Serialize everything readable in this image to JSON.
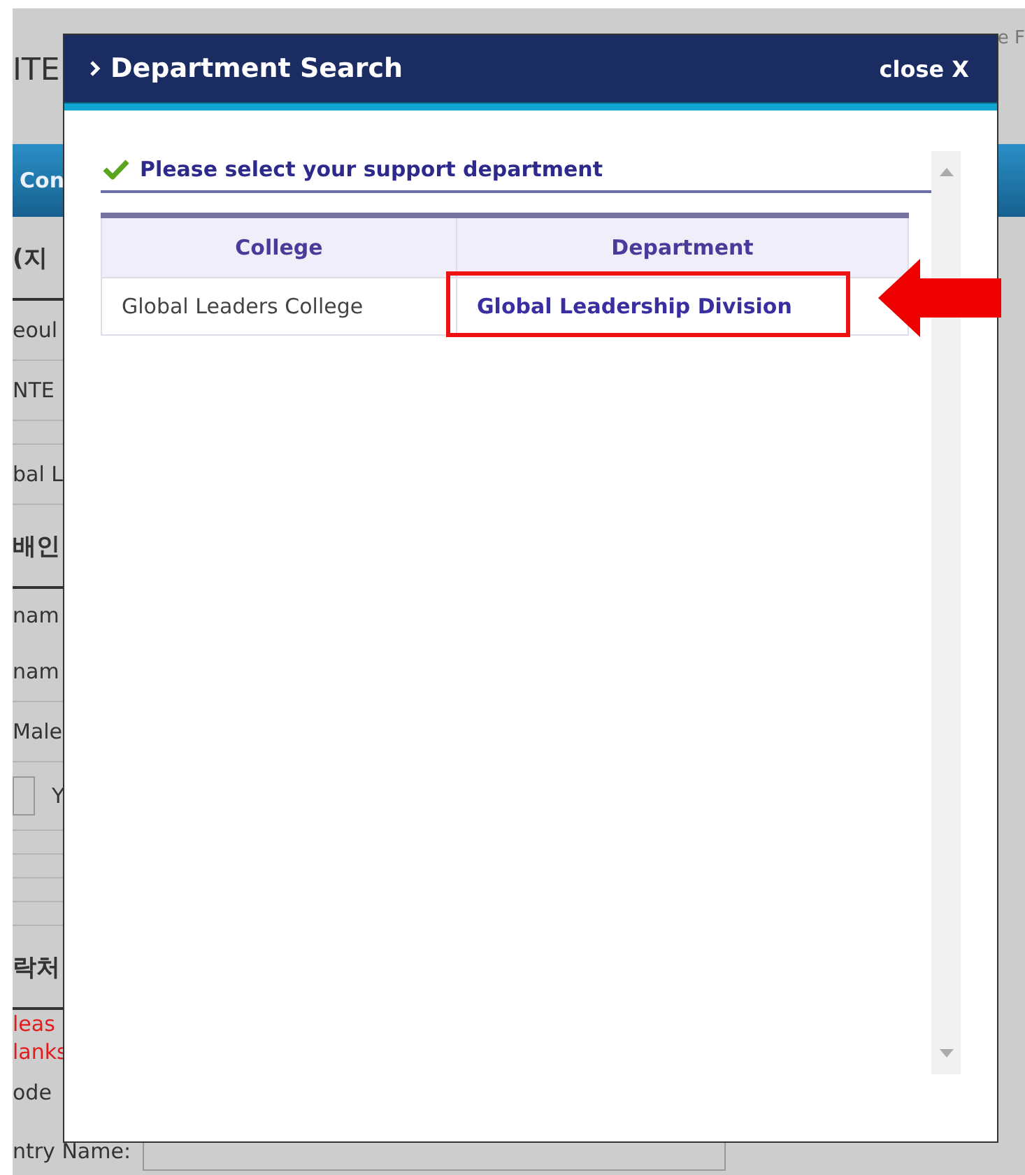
{
  "background_page": {
    "header_text": "ITE",
    "top_right_text": "e F",
    "tab_text": "Con",
    "rows": [
      {
        "kind": "heading",
        "text": "(지"
      },
      {
        "kind": "text",
        "text": "eoul"
      },
      {
        "kind": "text",
        "text": "NTE"
      },
      {
        "kind": "blank"
      },
      {
        "kind": "text",
        "text": "bal L"
      },
      {
        "kind": "heading",
        "text": "배인"
      },
      {
        "kind": "plain",
        "text": "nam"
      },
      {
        "kind": "text",
        "text": "nam"
      },
      {
        "kind": "text",
        "text": "Male"
      },
      {
        "kind": "input",
        "text": "Y"
      },
      {
        "kind": "blank"
      },
      {
        "kind": "blank"
      },
      {
        "kind": "blank"
      },
      {
        "kind": "blank"
      },
      {
        "kind": "heading",
        "text": "락처"
      },
      {
        "kind": "warning",
        "text": "leas"
      },
      {
        "kind": "warning",
        "text": "lanks"
      },
      {
        "kind": "plain",
        "text": "ode"
      },
      {
        "kind": "field",
        "text": "ntry Name:"
      }
    ]
  },
  "dialog": {
    "title": "Department Search",
    "close_label": "close X",
    "instruction": "Please select your support department",
    "table": {
      "columns": [
        "College",
        "Department"
      ],
      "rows": [
        {
          "college": "Global Leaders College",
          "department": "Global Leadership Division",
          "highlighted": true
        }
      ]
    }
  }
}
